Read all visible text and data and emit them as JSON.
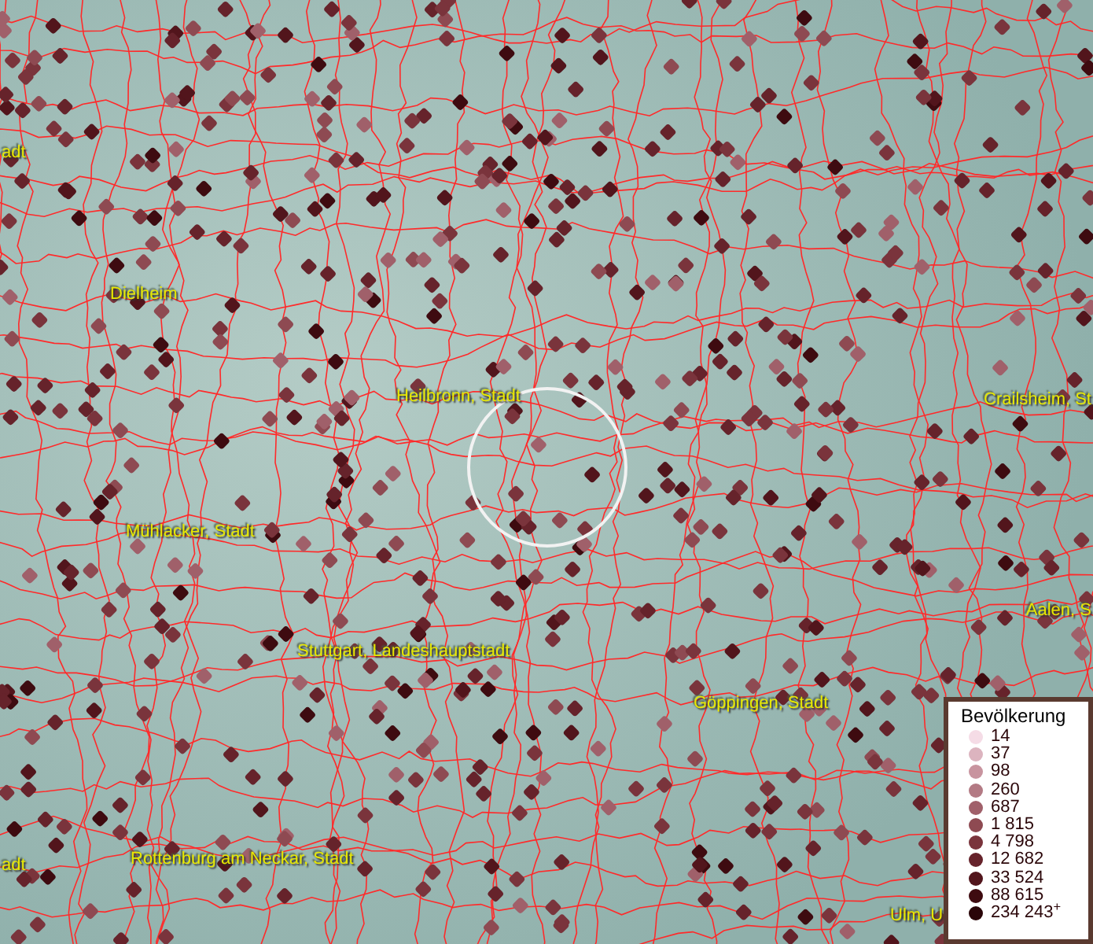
{
  "map": {
    "labels": [
      {
        "text": "adt"
      },
      {
        "text": "Dielheim"
      },
      {
        "text": "Heilbronn, Stadt"
      },
      {
        "text": "Crailsheim, St"
      },
      {
        "text": "Mühlacker, Stadt"
      },
      {
        "text": "Aalen, S"
      },
      {
        "text": "Stuttgart, Landeshauptstadt"
      },
      {
        "text": "Göppingen, Stadt"
      },
      {
        "text": "adt"
      },
      {
        "text": "Rottenburg am Neckar, Stadt"
      },
      {
        "text": "Ulm, U"
      }
    ]
  },
  "legend": {
    "title": "Bevölkerung",
    "items": [
      {
        "label": "14",
        "color": "#f5dce6"
      },
      {
        "label": "37",
        "color": "#dcb4bf"
      },
      {
        "label": "98",
        "color": "#c8949f"
      },
      {
        "label": "260",
        "color": "#b37a84"
      },
      {
        "label": "687",
        "color": "#a0606a"
      },
      {
        "label": "1 815",
        "color": "#8e4a52"
      },
      {
        "label": "4 798",
        "color": "#7a343c"
      },
      {
        "label": "12 682",
        "color": "#66232b"
      },
      {
        "label": "33 524",
        "color": "#52151c"
      },
      {
        "label": "88 615",
        "color": "#3e0b10"
      },
      {
        "label": "234 243$^{+}$",
        "color": "#2a0508"
      }
    ]
  }
}
